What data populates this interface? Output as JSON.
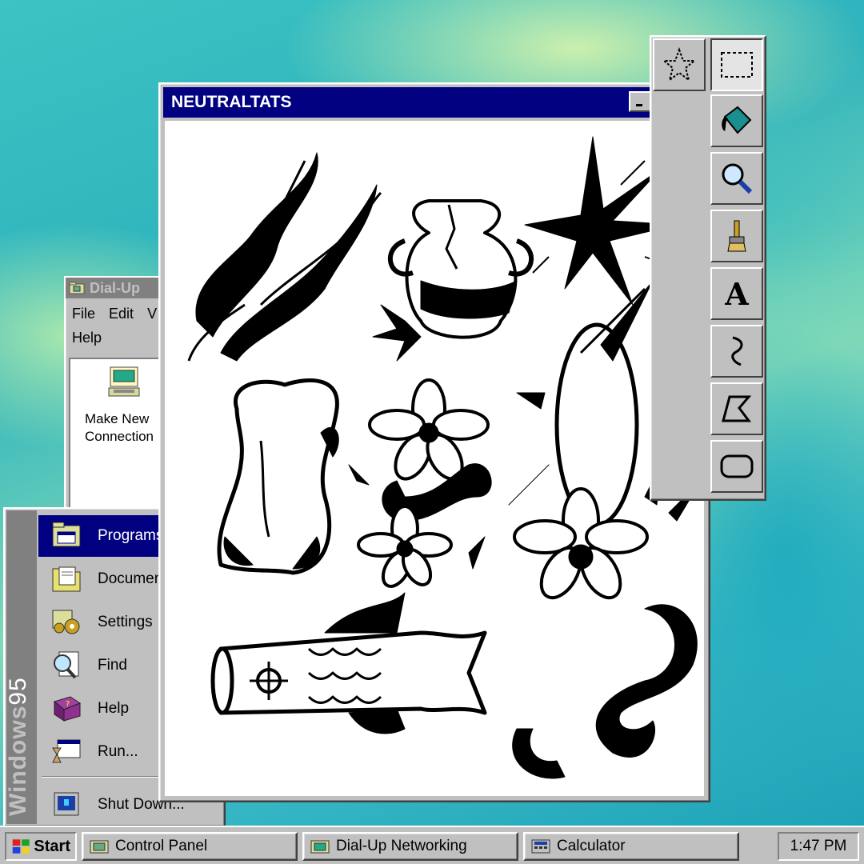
{
  "main_window": {
    "title": "NEUTRALTATS",
    "controls": {
      "minimize": "minimize-icon",
      "maximize": "maximize-icon",
      "close": "close-icon"
    }
  },
  "dialup_window": {
    "title": "Dial-Up",
    "menu": [
      {
        "label": "File"
      },
      {
        "label": "Edit"
      },
      {
        "label": "V"
      },
      {
        "label": "Help"
      }
    ],
    "item": {
      "label": "Make New\nConnection",
      "icon": "make-connection-icon"
    }
  },
  "start_menu": {
    "sidebar_brand": "Windows",
    "sidebar_version": "95",
    "items": [
      {
        "label": "Programs",
        "icon": "programs-icon",
        "active": true
      },
      {
        "label": "Documen",
        "icon": "documents-icon"
      },
      {
        "label": "Settings",
        "icon": "settings-icon"
      },
      {
        "label": "Find",
        "icon": "find-icon"
      },
      {
        "label": "Help",
        "icon": "help-book-icon"
      },
      {
        "label": "Run...",
        "icon": "run-icon"
      },
      {
        "label": "Shut Down...",
        "icon": "shutdown-icon"
      }
    ]
  },
  "toolbox": {
    "tools": [
      {
        "name": "free-select",
        "icon": "star-select-icon"
      },
      {
        "name": "rect-select",
        "icon": "rect-select-icon",
        "selected": true
      },
      {
        "name": "fill",
        "icon": "paint-bucket-icon"
      },
      {
        "name": "magnifier",
        "icon": "magnifier-icon"
      },
      {
        "name": "brush",
        "icon": "brush-icon"
      },
      {
        "name": "text",
        "icon": "text-tool-icon",
        "glyph": "A"
      },
      {
        "name": "curve",
        "icon": "curve-icon"
      },
      {
        "name": "polygon",
        "icon": "polygon-icon"
      },
      {
        "name": "rounded-rect",
        "icon": "rounded-rect-icon"
      }
    ]
  },
  "taskbar": {
    "start_label": "Start",
    "tasks": [
      {
        "label": "Control Panel",
        "icon": "control-panel-icon"
      },
      {
        "label": "Dial-Up Networking",
        "icon": "dialup-networking-icon"
      },
      {
        "label": "Calculator",
        "icon": "calculator-icon"
      }
    ],
    "clock": "1:47 PM"
  },
  "colors": {
    "title_active": "#000080",
    "title_inactive": "#808080",
    "face": "#c0c0c0",
    "desktop": "#2fb3bd"
  }
}
